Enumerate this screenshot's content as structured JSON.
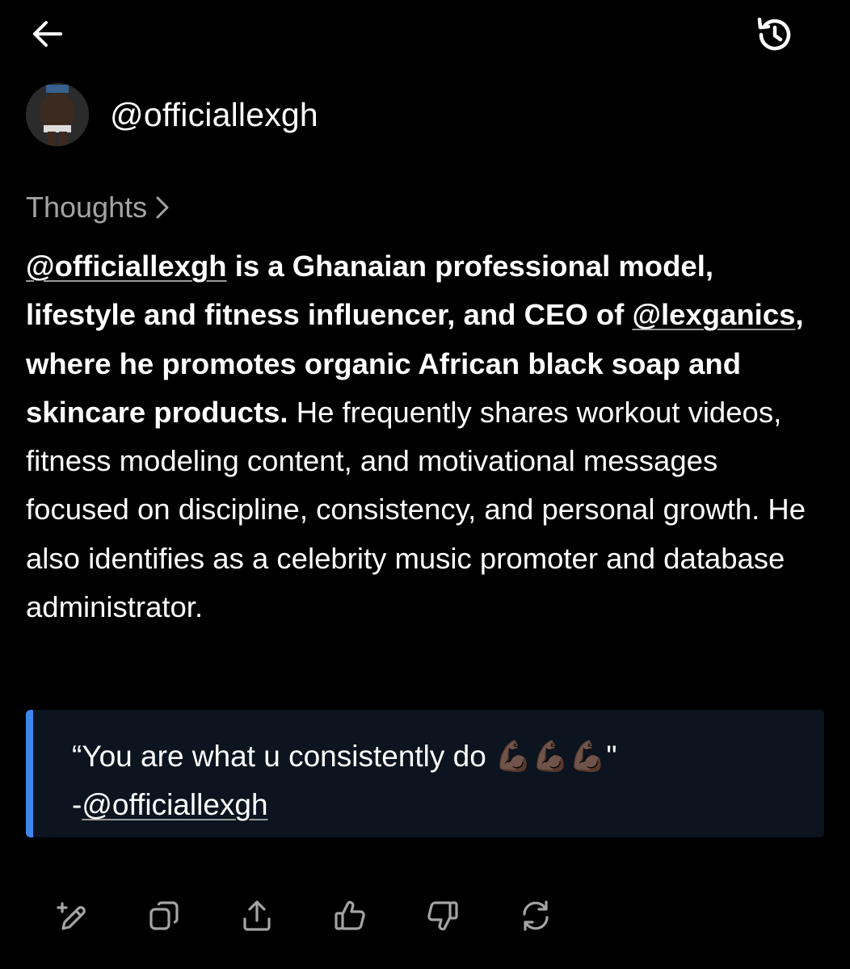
{
  "icons": {
    "back": "arrow-left-icon",
    "history": "history-icon",
    "thoughts_chevron": "chevron-right-icon",
    "actions": [
      "edit-plus-icon",
      "copy-icon",
      "share-icon",
      "thumbs-up-icon",
      "thumbs-down-icon",
      "regenerate-icon"
    ]
  },
  "profile": {
    "handle": "@officiallexgh"
  },
  "thoughts": {
    "label": "Thoughts"
  },
  "body": {
    "mention1": "@officiallexgh",
    "bold1": " is a Ghanaian professional model, lifestyle and fitness influencer, and CEO of ",
    "mention2": "@lexganics",
    "bold2": ", where he promotes organic African black soap and skincare products.",
    "rest": " He frequently shares workout videos, fitness modeling content, and motivational messages focused on discipline, consistency, and personal growth. He also identifies as a celebrity music promoter and database administrator."
  },
  "quote": {
    "text": "“You are what u consistently do ",
    "emoji": "💪🏿💪🏿💪🏿",
    "close": "\"",
    "attribution_prefix": "-",
    "attribution_mention": "@officiallexgh"
  },
  "colors": {
    "background": "#000000",
    "text": "#ffffff",
    "muted": "#a4a4a4",
    "quote_background": "#0b141f",
    "quote_accent": "#3d86ec"
  }
}
